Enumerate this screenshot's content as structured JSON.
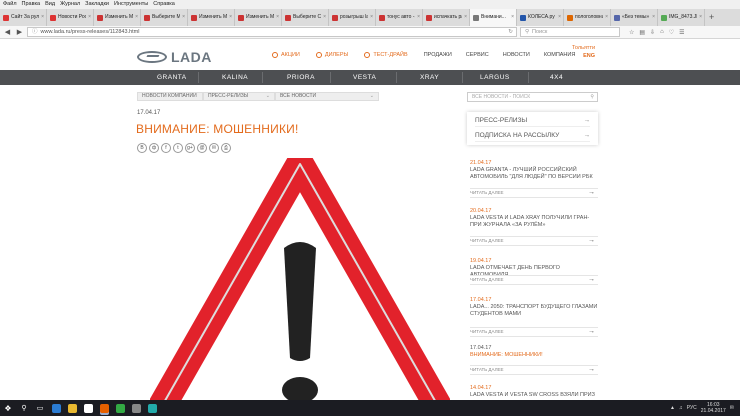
{
  "browser": {
    "menu": [
      "Файл",
      "Правка",
      "Вид",
      "Журнал",
      "Закладки",
      "Инструменты",
      "Справка"
    ],
    "tabs": [
      {
        "label": "Сайт За руле...",
        "color": "#d33"
      },
      {
        "label": "Новости Рос...",
        "color": "#d33"
      },
      {
        "label": "Изменить Ма...",
        "color": "#c33"
      },
      {
        "label": "Выберите Ма...",
        "color": "#c33"
      },
      {
        "label": "Изменить Ма...",
        "color": "#c33"
      },
      {
        "label": "Изменить Ма...",
        "color": "#c33"
      },
      {
        "label": "Выберите Сл...",
        "color": "#c33"
      },
      {
        "label": "розыгрыш la...",
        "color": "#c33"
      },
      {
        "label": "тонус авто -...",
        "color": "#c33"
      },
      {
        "label": "испачкать ра...",
        "color": "#c33"
      },
      {
        "label": "Внимани...",
        "color": "#777",
        "active": true
      },
      {
        "label": "КОЛЕСА.ру -...",
        "color": "#25a"
      },
      {
        "label": "пологоловна...",
        "color": "#d60"
      },
      {
        "label": "«Без темы» -...",
        "color": "#56a"
      },
      {
        "label": "IMG_8473.JPG...",
        "color": "#5a5"
      }
    ],
    "url": "www.lada.ru/press-releases/112843.html",
    "search_placeholder": "Поиск"
  },
  "site": {
    "logo_text": "LADA",
    "links": {
      "promo": "Акции",
      "dealers": "Дилеры",
      "test_drive": "Тест-драйв",
      "sales": "Продажи",
      "service": "Сервис",
      "news": "Новости",
      "company": "Компания"
    },
    "lang_top": "Тольятти",
    "lang_code": "ENG",
    "models": [
      "GRANTA",
      "KALINA",
      "PRIORA",
      "VESTA",
      "XRAY",
      "LARGUS",
      "4X4"
    ]
  },
  "article": {
    "breadcrumb_company": "Новости компании",
    "filter_releases": "Пресс-релизы",
    "filter_all": "Все новости",
    "date": "17.04.17",
    "title": "Внимание: мошенники!",
    "share": [
      "В",
      "ф",
      "f",
      "t",
      "g+",
      "@",
      "✉",
      "⎙"
    ]
  },
  "sidebar": {
    "search_placeholder": "Все новости - поиск",
    "menu": [
      "Пресс-релизы",
      "Подписка на рассылку"
    ],
    "read_more": "Читать далее",
    "news": [
      {
        "date": "21.04.17",
        "title": "LADA GRANTA - лучший российский автомобиль \"для людей\" по версии РБК"
      },
      {
        "date": "20.04.17",
        "title": "LADA VESTA и LADA XRAY получили Гран-при журнала «За рулём»"
      },
      {
        "date": "19.04.17",
        "title": "LADA отмечает день первого автомобиля"
      },
      {
        "date": "17.04.17",
        "title": "LADA... 2050: транспорт будущего глазами студентов МАМИ"
      },
      {
        "date": "17.04.17",
        "title": "Внимание: мошенники!"
      },
      {
        "date": "14.04.17",
        "title": "LADA VESTA и VESTA SW CROSS взяли приз"
      }
    ]
  },
  "taskbar": {
    "time": "16:03",
    "date": "21.04.2017",
    "lang": "РУС"
  }
}
